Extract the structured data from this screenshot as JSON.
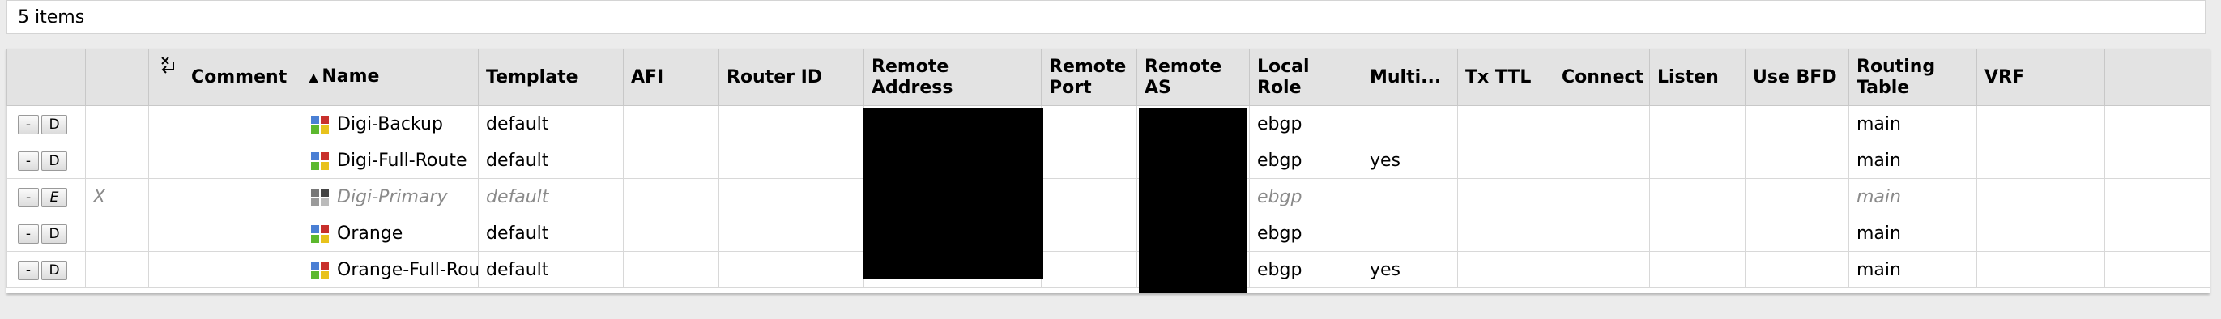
{
  "status": {
    "item_count": "5 items"
  },
  "columns": {
    "ctl": "",
    "flag": "",
    "comment": "Comment",
    "name": "Name",
    "name_sort": "▲",
    "template": "Template",
    "afi": "AFI",
    "router_id": "Router ID",
    "remote_address": "Remote Address",
    "remote_port": "Remote Port",
    "remote_as": "Remote AS",
    "local_role": "Local Role",
    "multihop": "Multi...",
    "tx_ttl": "Tx TTL",
    "connect": "Connect",
    "listen": "Listen",
    "use_bfd": "Use BFD",
    "routing_table": "Routing Table",
    "vrf": "VRF"
  },
  "buttons": {
    "remove": "-",
    "disable": "D",
    "enable": "E"
  },
  "colors": {
    "icon_blue": "#4a7fd4",
    "icon_red": "#c8302c",
    "icon_green": "#5cb82e",
    "icon_yellow": "#e8c21c",
    "icon_gray": "#9a9a9a",
    "redaction": "#000000"
  },
  "rows": [
    {
      "flag": "",
      "toggle": "D",
      "name": "Digi-Backup",
      "template": "default",
      "local_role": "ebgp",
      "multihop": "",
      "routing_table": "main",
      "disabled": false
    },
    {
      "flag": "",
      "toggle": "D",
      "name": "Digi-Full-Route",
      "template": "default",
      "local_role": "ebgp",
      "multihop": "yes",
      "routing_table": "main",
      "disabled": false
    },
    {
      "flag": "X",
      "toggle": "E",
      "name": "Digi-Primary",
      "template": "default",
      "local_role": "ebgp",
      "multihop": "",
      "routing_table": "main",
      "disabled": true
    },
    {
      "flag": "",
      "toggle": "D",
      "name": "Orange",
      "template": "default",
      "local_role": "ebgp",
      "multihop": "",
      "routing_table": "main",
      "disabled": false
    },
    {
      "flag": "",
      "toggle": "D",
      "name": "Orange-Full-Route",
      "template": "default",
      "local_role": "ebgp",
      "multihop": "yes",
      "routing_table": "main",
      "disabled": false
    }
  ]
}
